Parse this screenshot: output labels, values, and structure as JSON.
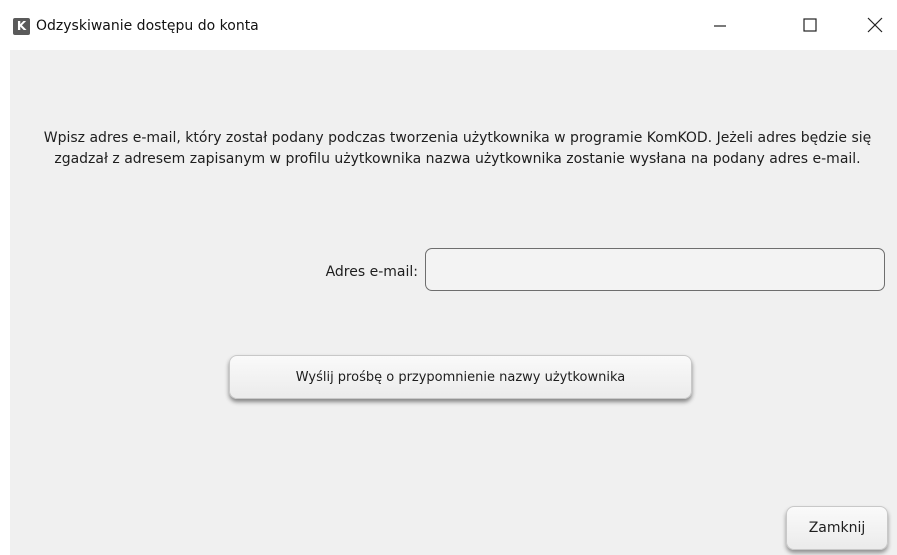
{
  "window": {
    "icon_letter": "K",
    "title": "Odzyskiwanie dostępu do konta",
    "controls": {
      "minimize_icon": "minimize-icon",
      "maximize_icon": "maximize-icon",
      "close_icon": "close-icon"
    }
  },
  "main": {
    "description": "Wpisz adres e-mail, który został podany podczas tworzenia użytkownika w programie KomKOD. Jeżeli adres będzie się zgadzał z adresem zapisanym w profilu użytkownika nazwa użytkownika zostanie wysłana na podany adres e-mail.",
    "email_label": "Adres e-mail:",
    "email_value": "",
    "send_button_label": "Wyślij prośbę o przypomnienie nazwy użytkownika",
    "close_button_label": "Zamknij"
  },
  "colors": {
    "content_background": "#f0f0f0",
    "titlebar_background": "#ffffff",
    "app_icon_background": "#5a5a5a"
  }
}
